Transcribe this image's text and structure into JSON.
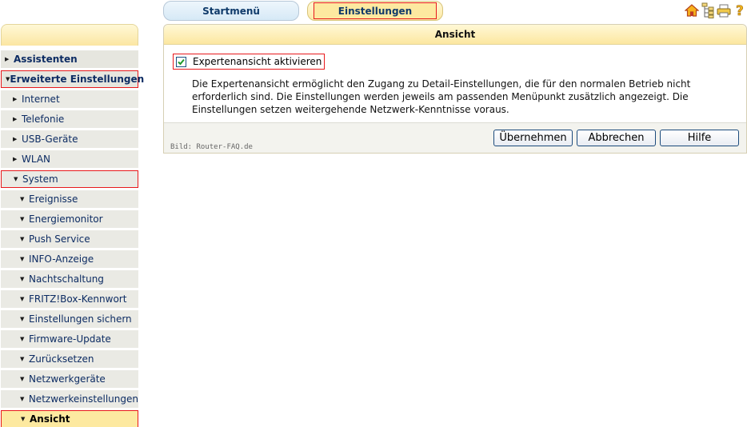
{
  "tabs": {
    "start_label": "Startmenü",
    "settings_label": "Einstellungen"
  },
  "top_icons": [
    "home-icon",
    "sitemap-icon",
    "print-icon",
    "help-icon"
  ],
  "sidebar": {
    "items": [
      {
        "label": "Assistenten",
        "level": 0,
        "arrow": "right"
      },
      {
        "label": "Erweiterte Einstellungen",
        "level": 0,
        "arrow": "down"
      },
      {
        "label": "Internet",
        "level": 1,
        "arrow": "right"
      },
      {
        "label": "Telefonie",
        "level": 1,
        "arrow": "right"
      },
      {
        "label": "USB-Geräte",
        "level": 1,
        "arrow": "right"
      },
      {
        "label": "WLAN",
        "level": 1,
        "arrow": "right"
      },
      {
        "label": "System",
        "level": 1,
        "arrow": "down"
      },
      {
        "label": "Ereignisse",
        "level": 2,
        "arrow": "down"
      },
      {
        "label": "Energiemonitor",
        "level": 2,
        "arrow": "down"
      },
      {
        "label": "Push Service",
        "level": 2,
        "arrow": "down"
      },
      {
        "label": "INFO-Anzeige",
        "level": 2,
        "arrow": "down"
      },
      {
        "label": "Nachtschaltung",
        "level": 2,
        "arrow": "down"
      },
      {
        "label": "FRITZ!Box-Kennwort",
        "level": 2,
        "arrow": "down"
      },
      {
        "label": "Einstellungen sichern",
        "level": 2,
        "arrow": "down"
      },
      {
        "label": "Firmware-Update",
        "level": 2,
        "arrow": "down"
      },
      {
        "label": "Zurücksetzen",
        "level": 2,
        "arrow": "down"
      },
      {
        "label": "Netzwerkgeräte",
        "level": 2,
        "arrow": "down"
      },
      {
        "label": "Netzwerkeinstellungen",
        "level": 2,
        "arrow": "down"
      },
      {
        "label": "Ansicht",
        "level": 2,
        "arrow": "down"
      }
    ]
  },
  "panel": {
    "title": "Ansicht",
    "checkbox_label": "Expertenansicht aktivieren",
    "checkbox_checked": true,
    "description": "Die Expertenansicht ermöglicht den Zugang zu Detail-Einstellungen, die für den normalen Betrieb nicht erforderlich sind. Die Einstellungen werden jeweils am passenden Menüpunkt zusätzlich angezeigt. Die Einstellungen setzen weitergehende Netzwerk-Kenntnisse voraus.",
    "credit": "Bild: Router-FAQ.de",
    "buttons": {
      "apply": "Übernehmen",
      "cancel": "Abbrechen",
      "help": "Hilfe"
    }
  },
  "colors": {
    "highlight_border": "#e8191c",
    "active_item": "#fde9a0",
    "nav_text": "#0d2c63"
  }
}
